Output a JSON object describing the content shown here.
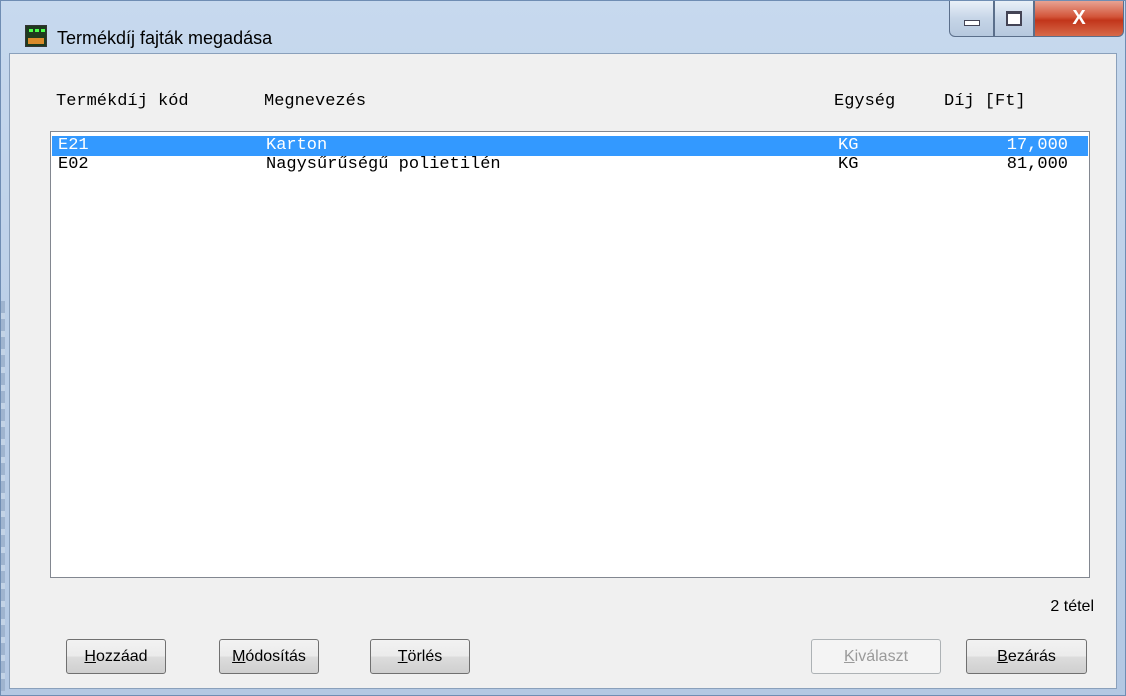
{
  "window": {
    "title": "Termékdíj fajták megadása",
    "close_glyph": "X"
  },
  "columns": {
    "code": "Termékdíj kód",
    "name": "Megnevezés",
    "unit": "Egység",
    "fee": "Díj [Ft]"
  },
  "rows": [
    {
      "code": "E21",
      "name": "Karton",
      "unit": "KG",
      "fee": "17,000",
      "selected": true
    },
    {
      "code": "E02",
      "name": "Nagysűrűségű polietilén",
      "unit": "KG",
      "fee": "81,000",
      "selected": false
    }
  ],
  "status": {
    "count": "2 tétel"
  },
  "buttons": {
    "add": {
      "label": "Hozzáad",
      "mnemonic": "H",
      "rest": "ozzáad"
    },
    "modify": {
      "label": "Módosítás",
      "mnemonic": "M",
      "rest": "ódosítás"
    },
    "delete": {
      "label": "Törlés",
      "mnemonic": "T",
      "rest": "örlés"
    },
    "select": {
      "label": "Kiválaszt",
      "mnemonic": "K",
      "rest": "iválaszt",
      "disabled": true
    },
    "close": {
      "label": "Bezárás",
      "mnemonic": "B",
      "rest": "ezárás"
    }
  },
  "colors": {
    "selection": "#3399ff",
    "close_button": "#c2351a"
  }
}
